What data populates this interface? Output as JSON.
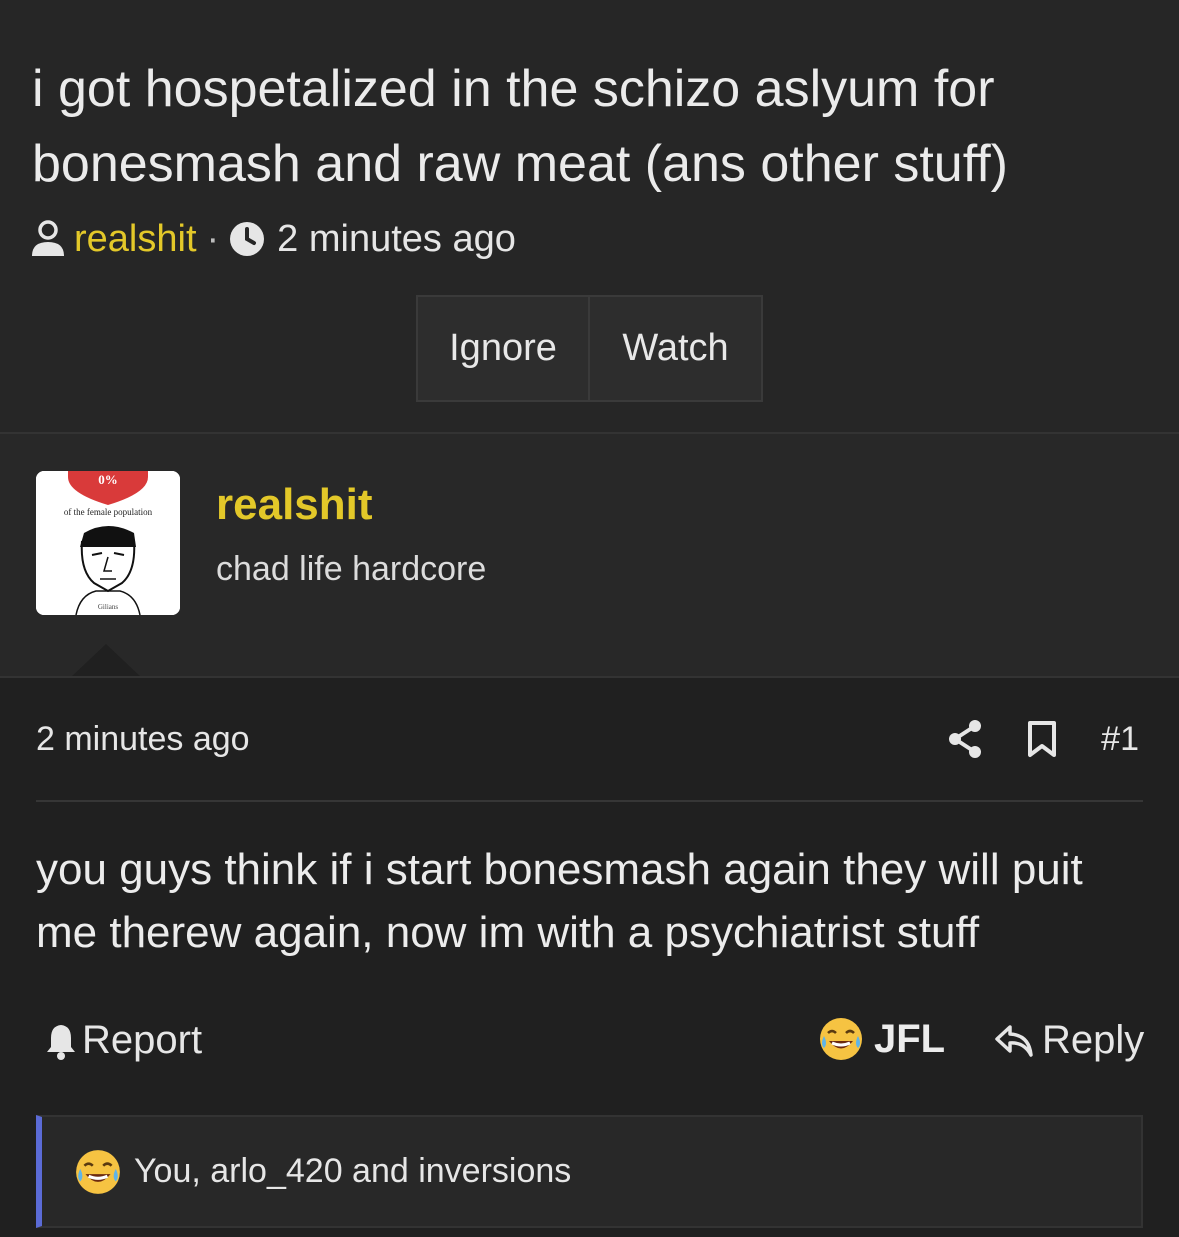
{
  "thread": {
    "title": "i got hospetalized in the schizo aslyum for bonesmash and raw meat (ans other stuff)",
    "author": "realshit",
    "separator": "·",
    "time": "2 minutes ago",
    "buttons": {
      "ignore": "Ignore",
      "watch": "Watch"
    }
  },
  "user": {
    "avatar_text_top": "0%",
    "avatar_text_caption": "of the female population",
    "avatar_text_shirt": "Gilians",
    "name": "realshit",
    "title": "chad life hardcore"
  },
  "post": {
    "time": "2 minutes ago",
    "number": "#1",
    "body": "you guys think if i start bonesmash again they will puit me therew again, now im with a psychiatrist stuff",
    "report_label": "Report",
    "reaction_label": "JFL",
    "reply_label": "Reply",
    "reactions_summary": "You, arlo_420 and inversions"
  },
  "colors": {
    "accent_yellow": "#e3c829",
    "reaction_bar": "#5b6bd6",
    "background": "#262626"
  }
}
